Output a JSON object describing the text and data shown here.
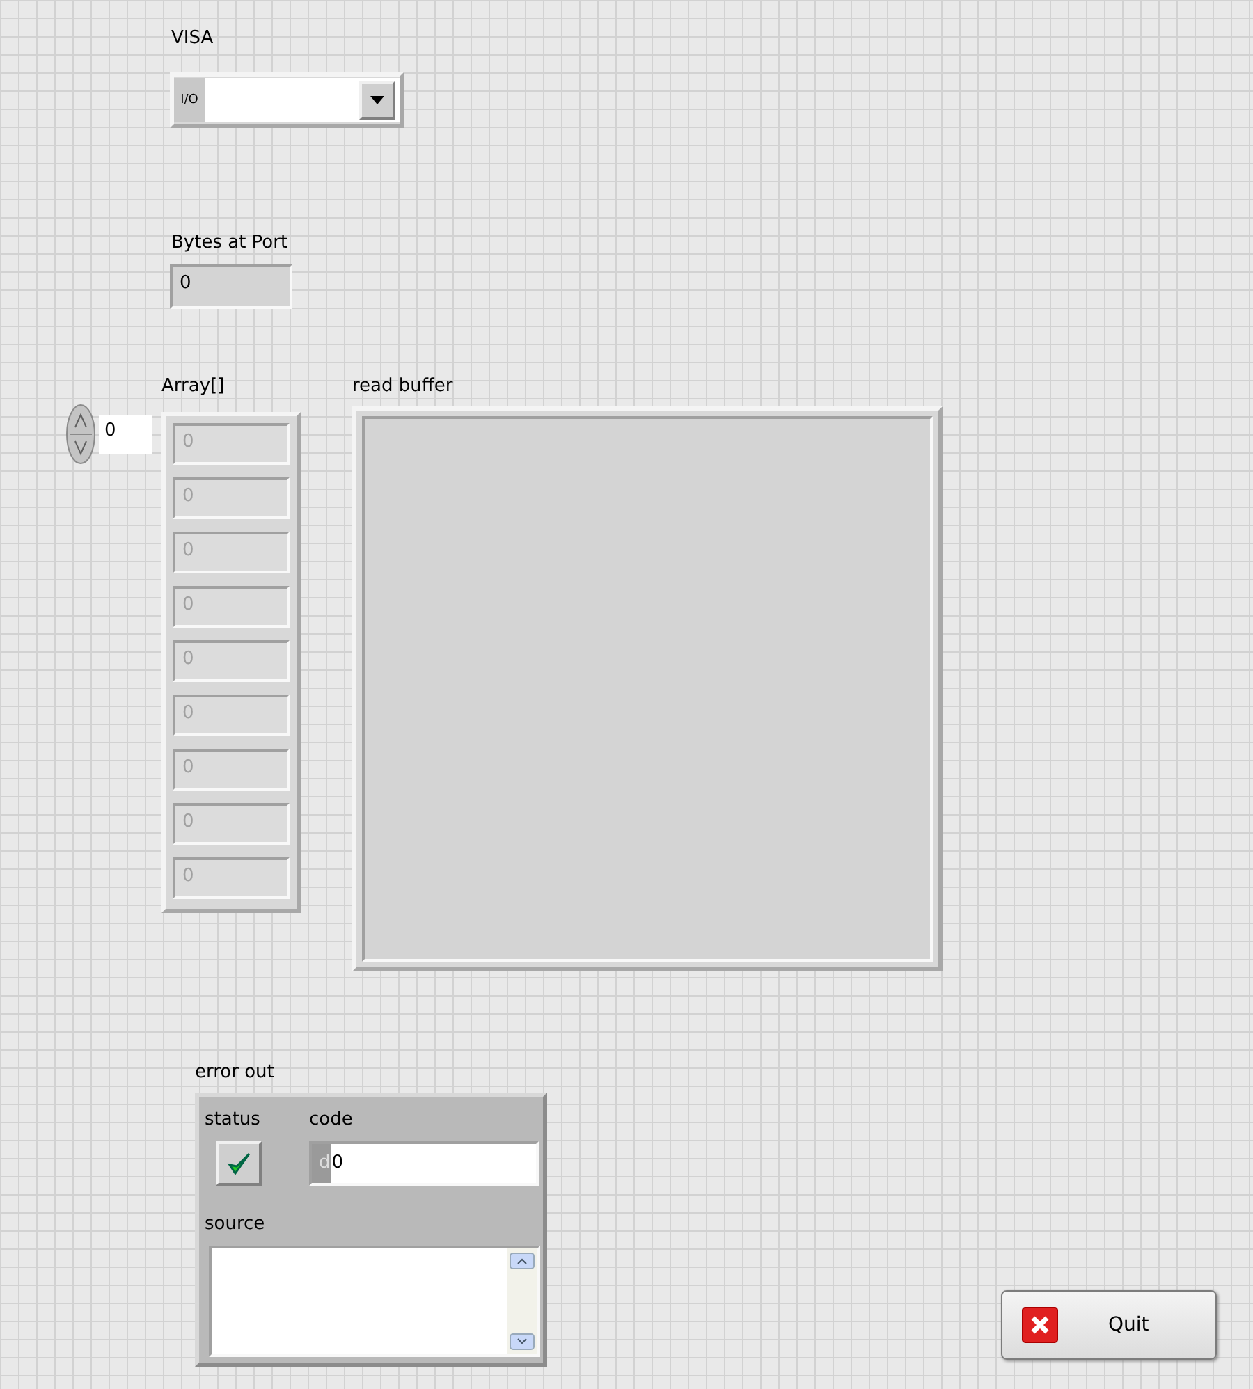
{
  "visa": {
    "label": "VISA",
    "prefix": "I/O"
  },
  "bytes_at_port": {
    "label": "Bytes at Port",
    "value": "0"
  },
  "array": {
    "label": "Array[]",
    "index": "0",
    "elements": [
      {
        "value": "0",
        "disabled": true
      },
      {
        "value": "0",
        "disabled": true
      },
      {
        "value": "0",
        "disabled": true
      },
      {
        "value": "0",
        "disabled": true
      },
      {
        "value": "0",
        "disabled": true
      },
      {
        "value": "0",
        "disabled": true
      },
      {
        "value": "0",
        "disabled": true
      },
      {
        "value": "0",
        "disabled": true
      },
      {
        "value": "0",
        "disabled": true
      }
    ]
  },
  "read_buffer": {
    "label": "read buffer"
  },
  "error_out": {
    "label": "error out",
    "status_label": "status",
    "status_ok": true,
    "code_label": "code",
    "radix": "d",
    "code": "0",
    "source_label": "source"
  },
  "quit_button": {
    "label": "Quit"
  }
}
